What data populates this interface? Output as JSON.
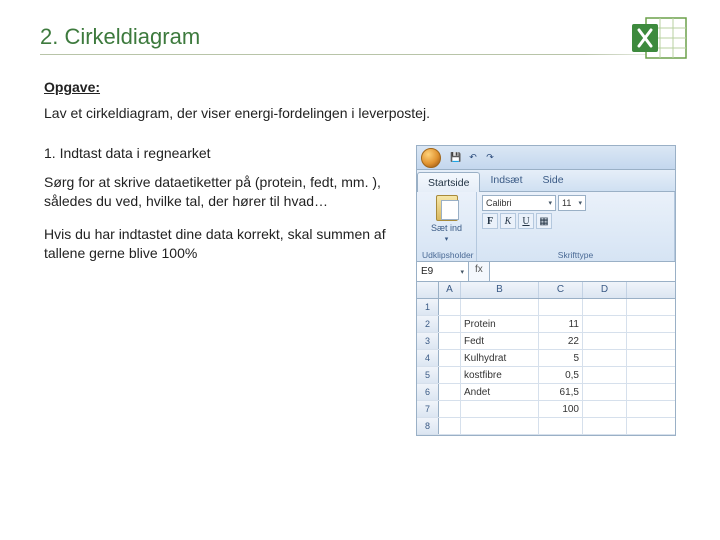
{
  "header": {
    "title": "2. Cirkeldiagram"
  },
  "subhead": "Opgave:",
  "intro": "Lav et cirkeldiagram, der viser energi-fordelingen i leverpostej.",
  "step_title": "1. Indtast data i regnearket",
  "para1": "Sørg for at skrive dataetiketter på (protein, fedt, mm. ), således du ved, hvilke tal, der hører til hvad…",
  "para2": "Hvis du har indtastet dine data korrekt, skal summen af tallene gerne blive 100%",
  "excel": {
    "tabs": {
      "home": "Startside",
      "insert": "Indsæt",
      "layout": "Side"
    },
    "ribbon": {
      "paste": "Sæt ind",
      "clipboard_group": "Udklipsholder",
      "font_group": "Skrifttype",
      "font_name": "Calibri",
      "font_size": "11",
      "bold": "F",
      "italic": "K",
      "underline": "U"
    },
    "namebox": "E9",
    "fx": "fx",
    "columns": [
      "A",
      "B",
      "C",
      "D"
    ],
    "rows": [
      {
        "n": "1",
        "a": "",
        "b": "",
        "c": "",
        "d": ""
      },
      {
        "n": "2",
        "a": "",
        "b": "Protein",
        "c": "11",
        "d": ""
      },
      {
        "n": "3",
        "a": "",
        "b": "Fedt",
        "c": "22",
        "d": ""
      },
      {
        "n": "4",
        "a": "",
        "b": "Kulhydrat",
        "c": "5",
        "d": ""
      },
      {
        "n": "5",
        "a": "",
        "b": "kostfibre",
        "c": "0,5",
        "d": ""
      },
      {
        "n": "6",
        "a": "",
        "b": "Andet",
        "c": "61,5",
        "d": ""
      },
      {
        "n": "7",
        "a": "",
        "b": "",
        "c": "100",
        "d": ""
      },
      {
        "n": "8",
        "a": "",
        "b": "",
        "c": "",
        "d": ""
      }
    ]
  }
}
